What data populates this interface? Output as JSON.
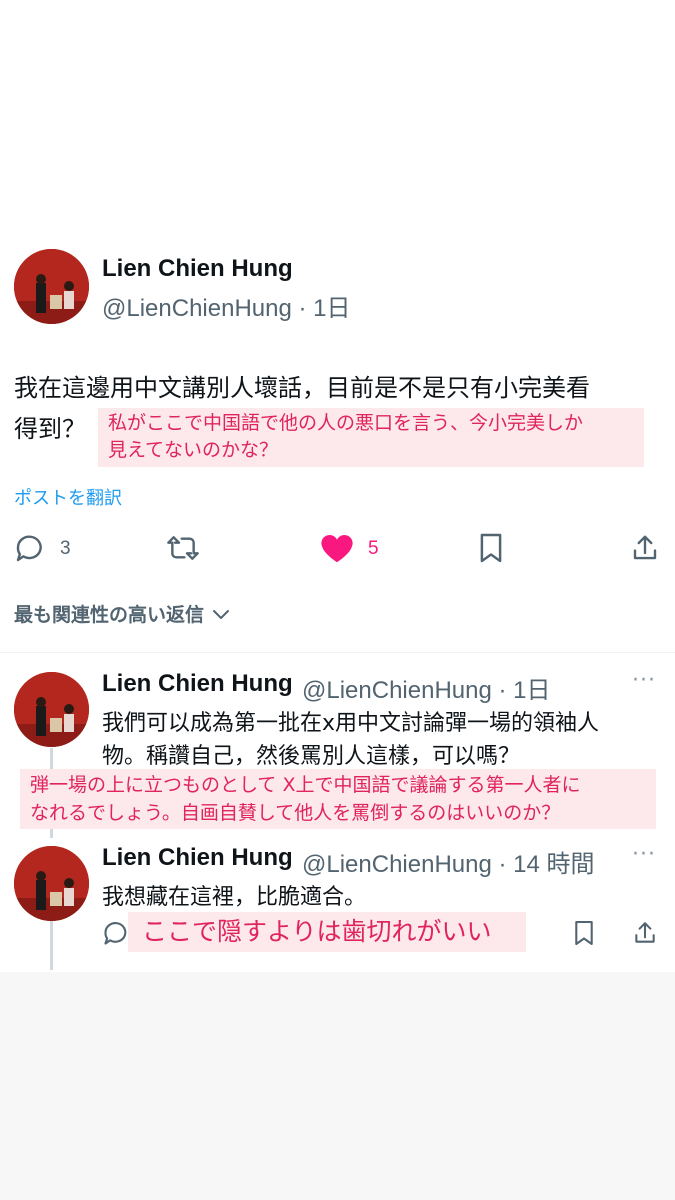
{
  "main_tweet": {
    "author_name": "Lien Chien Hung",
    "handle_time": "@LienChienHung · 1日",
    "text_line1": "我在這邊用中文講別人壞話，目前是不是只有小完美看",
    "text_line2": "得到？",
    "overlay_line1": "私がここで中国語で他の人の悪口を言う、今小完美しか",
    "overlay_line2": "見えてないのかな？",
    "translate_label": "ポストを翻訳",
    "reply_count": "3",
    "like_count": "5",
    "like_color": "#f91880"
  },
  "sort": {
    "label": "最も関連性の高い返信"
  },
  "reply1": {
    "author_name": "Lien Chien Hung",
    "handle_time": "@LienChienHung · 1日",
    "text_line1": "我們可以成為第一批在x用中文討論彈一場的領袖人",
    "text_line2": "物。稱讚自己，然後罵別人這樣，可以嗎？",
    "overlay_line1": "弾一場の上に立つものとして  X上で中国語で議論する第一人者に",
    "overlay_line2": "なれるでしょう。自画自賛して他人を罵倒するのはいいのか？"
  },
  "reply2": {
    "author_name": "Lien Chien Hung",
    "handle_time": "@LienChienHung · 14 時間",
    "text": "我想藏在這裡，比脆適合。",
    "overlay": "ここで隠すよりは歯切れがいい"
  }
}
